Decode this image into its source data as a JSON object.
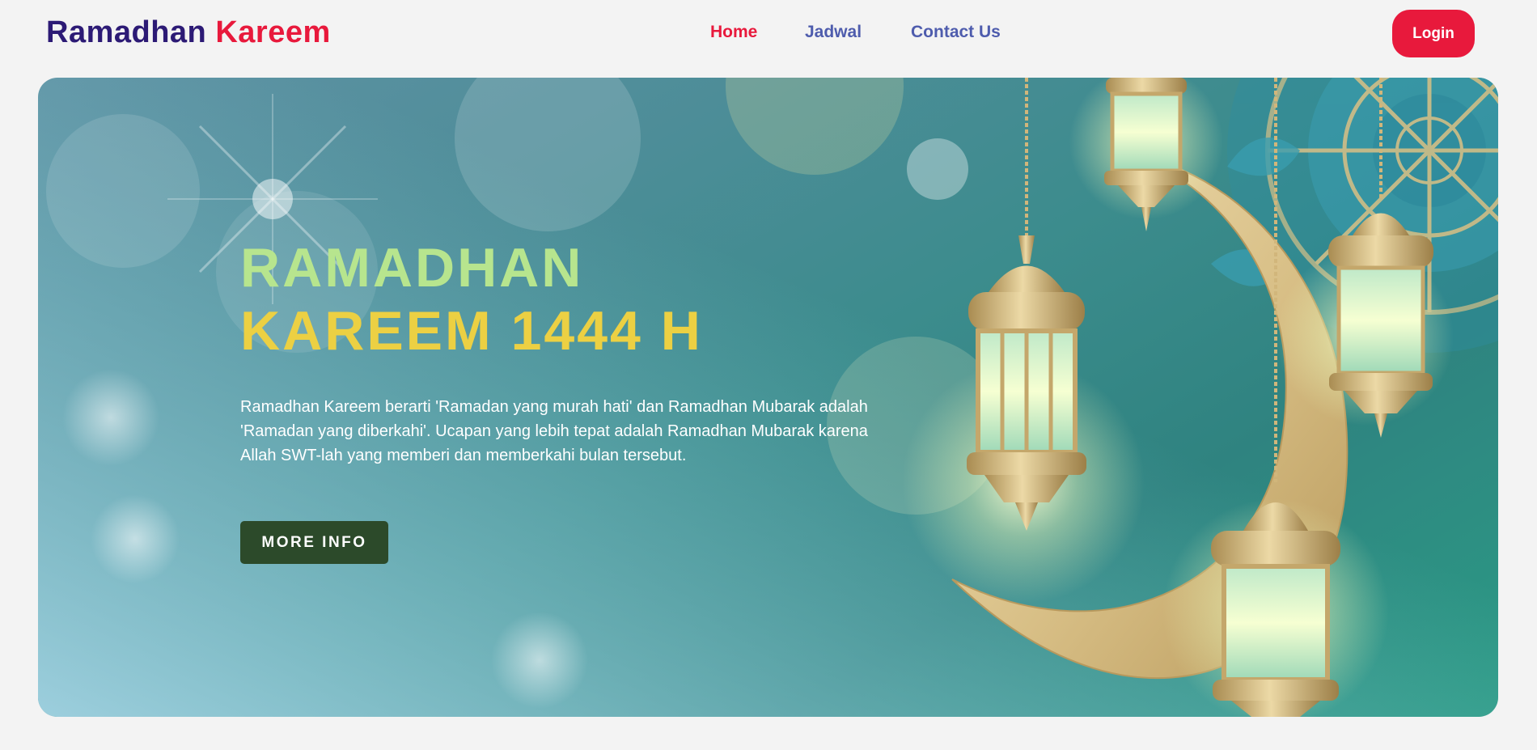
{
  "header": {
    "logo_part1": "Ramadhan",
    "logo_part2": "Kareem",
    "nav": [
      {
        "label": "Home",
        "active": true
      },
      {
        "label": "Jadwal",
        "active": false
      },
      {
        "label": "Contact Us",
        "active": false
      }
    ],
    "login_label": "Login"
  },
  "hero": {
    "title_line1": "RAMADHAN",
    "title_line2": "KAREEM 1444 H",
    "description": "Ramadhan Kareem berarti 'Ramadan yang murah hati' dan Ramadhan Mubarak adalah 'Ramadan yang diberkahi'. Ucapan yang lebih tepat adalah Ramadhan Mubarak karena Allah SWT-lah yang memberi dan memberkahi bulan tersebut.",
    "button_label": "MORE INFO",
    "illustration": [
      "crescent-moon",
      "hanging-lanterns",
      "mandala-ornament",
      "bokeh-lights"
    ]
  },
  "colors": {
    "page_bg": "#f3f3f3",
    "logo_primary": "#2c1a75",
    "accent_red": "#e8193c",
    "nav_inactive": "#4e5cad",
    "title_line1": "#b7e58e",
    "title_line2": "#ecd043",
    "button_bg": "#2c4a2a"
  }
}
